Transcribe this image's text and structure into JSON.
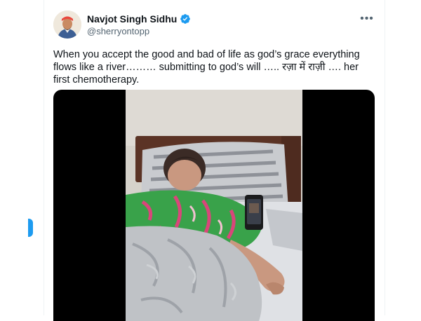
{
  "colors": {
    "accent": "#1d9bf0",
    "text_primary": "#0f1419",
    "text_secondary": "#536471",
    "media_background": "#000000"
  },
  "post": {
    "author": {
      "display_name": "Navjot Singh Sidhu",
      "handle": "@sherryontopp",
      "verified": true,
      "avatar_icon": "avatar-photo"
    },
    "more_icon": "more-horizontal-icon",
    "more_label": "•••",
    "text": "When you accept the good and bad of life as god’s grace everything flows like a river……… submitting to god’s will ….. रज़ा में राज़ी …. her first chemotherapy.",
    "media": {
      "type": "video",
      "description_icon": "video-thumbnail"
    }
  }
}
